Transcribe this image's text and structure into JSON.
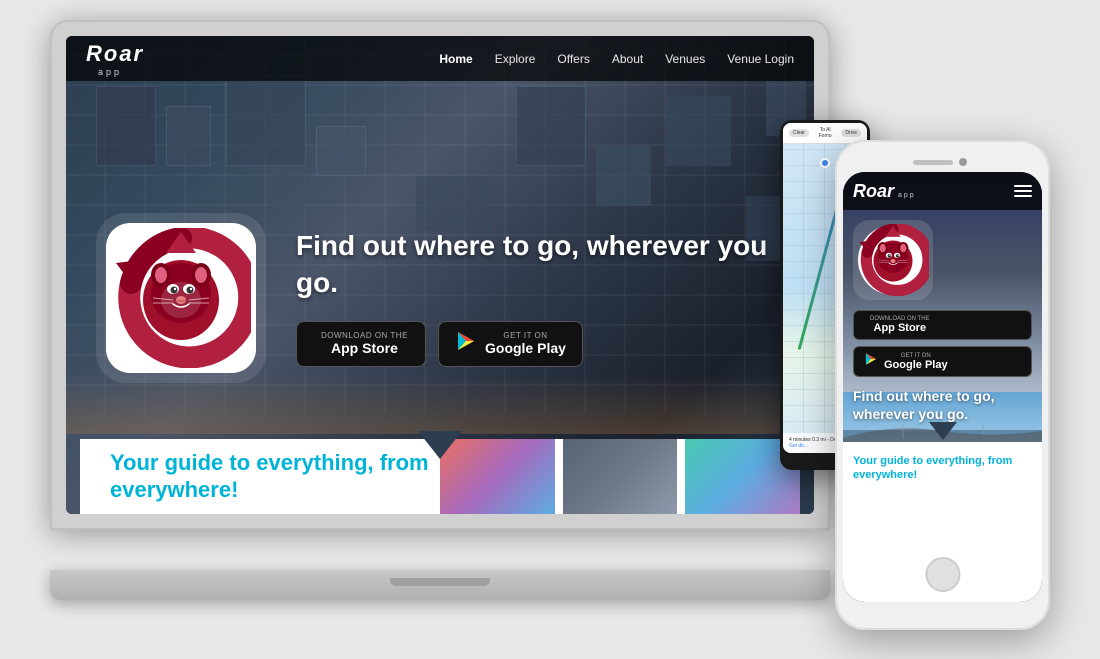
{
  "scene": {
    "bg_color": "#e0e0e0"
  },
  "laptop": {
    "nav": {
      "logo": "Roar",
      "logo_sub": "app",
      "links": [
        "Home",
        "Explore",
        "Offers",
        "About",
        "Venues",
        "Venue Login"
      ]
    },
    "hero": {
      "headline": "Find out where to go, wherever you go.",
      "app_store_pre": "Download on the",
      "app_store_name": "App Store",
      "play_store_pre": "GET IT ON",
      "play_store_name": "Google Play"
    },
    "lower": {
      "headline_line1": "Your guide to everything, from",
      "headline_line2": "everywhere!"
    }
  },
  "phone_android": {
    "map_header_clear": "Clear",
    "map_header_dest": "To Al Forno",
    "map_header_drive": "Drive",
    "map_footer": "4 minutes  0.3 mi - Devonshire",
    "get_directions": "Get dir..."
  },
  "phone_iphone": {
    "nav": {
      "logo": "Roar",
      "logo_sub": "app"
    },
    "app_store_pre": "Download on the",
    "app_store_name": "App Store",
    "play_store_pre": "GET IT ON",
    "play_store_name": "Google Play",
    "hero_text": "Find out where to go, wherever you go.",
    "lower": {
      "headline": "Your guide to everything, from everywhere!"
    }
  }
}
